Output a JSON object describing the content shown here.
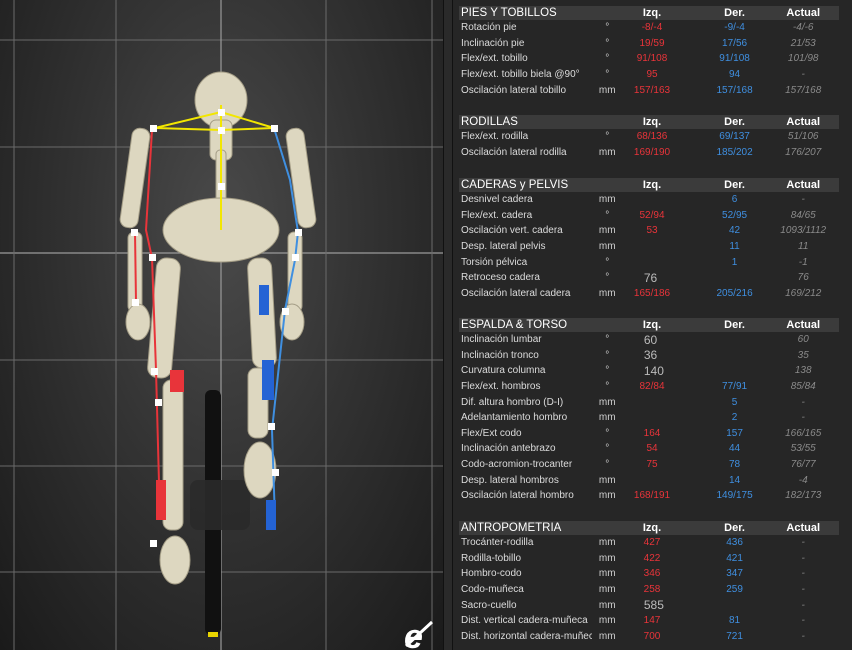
{
  "logo_text": "e",
  "sections": [
    {
      "title": "PIES Y TOBILLOS",
      "headers": {
        "izq": "Izq.",
        "der": "Der.",
        "act": "Actual"
      },
      "rows": [
        {
          "label": "Rotación pie",
          "unit": "°",
          "izq": "-8/-4",
          "der": "-9/-4",
          "act": "-4/-6"
        },
        {
          "label": "Inclinación pie",
          "unit": "°",
          "izq": "19/59",
          "der": "17/56",
          "act": "21/53"
        },
        {
          "label": "Flex/ext. tobillo",
          "unit": "°",
          "izq": "91/108",
          "der": "91/108",
          "act": "101/98"
        },
        {
          "label": "Flex/ext. tobillo biela @90°",
          "unit": "°",
          "izq": "95",
          "der": "94",
          "act": "-"
        },
        {
          "label": "Oscilación lateral tobillo",
          "unit": "mm",
          "izq": "157/163",
          "der": "157/168",
          "act": "157/168"
        }
      ]
    },
    {
      "title": "RODILLAS",
      "headers": {
        "izq": "Izq.",
        "der": "Der.",
        "act": "Actual"
      },
      "rows": [
        {
          "label": "Flex/ext. rodilla",
          "unit": "°",
          "izq": "68/136",
          "der": "69/137",
          "act": "51/106"
        },
        {
          "label": "Oscilación lateral rodilla",
          "unit": "mm",
          "izq": "169/190",
          "der": "185/202",
          "act": "176/207"
        }
      ]
    },
    {
      "title": "CADERAS y PELVIS",
      "headers": {
        "izq": "Izq.",
        "der": "Der.",
        "act": "Actual"
      },
      "rows": [
        {
          "label": "Desnivel cadera",
          "unit": "mm",
          "izq": "",
          "der": "6",
          "act": "-"
        },
        {
          "label": "Flex/ext. cadera",
          "unit": "°",
          "izq": "52/94",
          "der": "52/95",
          "act": "84/65"
        },
        {
          "label": "Oscilación vert. cadera",
          "unit": "mm",
          "izq": "53",
          "der": "42",
          "act": "1093/1112"
        },
        {
          "label": "Desp. lateral pelvis",
          "unit": "mm",
          "izq": "",
          "der": "11",
          "act": "11"
        },
        {
          "label": "Torsión pélvica",
          "unit": "°",
          "izq": "",
          "der": "1",
          "act": "-1"
        },
        {
          "label": "Retroceso cadera",
          "unit": "°",
          "izq": "",
          "center": "76",
          "der": "",
          "act": "76"
        },
        {
          "label": "Oscilación lateral cadera",
          "unit": "mm",
          "izq": "165/186",
          "der": "205/216",
          "act": "169/212"
        }
      ]
    },
    {
      "title": "ESPALDA & TORSO",
      "headers": {
        "izq": "Izq.",
        "der": "Der.",
        "act": "Actual"
      },
      "rows": [
        {
          "label": "Inclinación lumbar",
          "unit": "°",
          "izq": "",
          "center": "60",
          "der": "",
          "act": "60"
        },
        {
          "label": "Inclinación tronco",
          "unit": "°",
          "izq": "",
          "center": "36",
          "der": "",
          "act": "35"
        },
        {
          "label": "Curvatura columna",
          "unit": "°",
          "izq": "",
          "center": "140",
          "der": "",
          "act": "138"
        },
        {
          "label": "Flex/ext. hombros",
          "unit": "°",
          "izq": "82/84",
          "der": "77/91",
          "act": "85/84"
        },
        {
          "label": "Dif. altura hombro (D-I)",
          "unit": "mm",
          "izq": "",
          "der": "5",
          "act": "-"
        },
        {
          "label": "Adelantamiento hombro",
          "unit": "mm",
          "izq": "",
          "der": "2",
          "act": "-"
        },
        {
          "label": "Flex/Ext codo",
          "unit": "°",
          "izq": "164",
          "der": "157",
          "act": "166/165"
        },
        {
          "label": "Inclinación antebrazo",
          "unit": "°",
          "izq": "54",
          "der": "44",
          "act": "53/55"
        },
        {
          "label": "Codo-acromion-trocanter",
          "unit": "°",
          "izq": "75",
          "der": "78",
          "act": "76/77"
        },
        {
          "label": "Desp. lateral hombros",
          "unit": "mm",
          "izq": "",
          "der": "14",
          "act": "-4"
        },
        {
          "label": "Oscilación lateral hombro",
          "unit": "mm",
          "izq": "168/191",
          "der": "149/175",
          "act": "182/173"
        }
      ]
    },
    {
      "title": "ANTROPOMETRÍA",
      "headers": {
        "izq": "Izq.",
        "der": "Der.",
        "act": "Actual"
      },
      "rows": [
        {
          "label": "Trocánter-rodilla",
          "unit": "mm",
          "izq": "427",
          "der": "436",
          "act": "-"
        },
        {
          "label": "Rodilla-tobillo",
          "unit": "mm",
          "izq": "422",
          "der": "421",
          "act": "-"
        },
        {
          "label": "Hombro-codo",
          "unit": "mm",
          "izq": "346",
          "der": "347",
          "act": "-"
        },
        {
          "label": "Codo-muñeca",
          "unit": "mm",
          "izq": "258",
          "der": "259",
          "act": "-"
        },
        {
          "label": "Sacro-cuello",
          "unit": "mm",
          "izq": "",
          "center": "585",
          "der": "",
          "act": "-"
        },
        {
          "label": "Dist. vertical cadera-muñeca",
          "unit": "mm",
          "izq": "147",
          "der": "81",
          "act": "-"
        },
        {
          "label": "Dist. horizontal cadera-muñeca",
          "unit": "mm",
          "izq": "700",
          "der": "721",
          "act": "-"
        }
      ]
    }
  ]
}
